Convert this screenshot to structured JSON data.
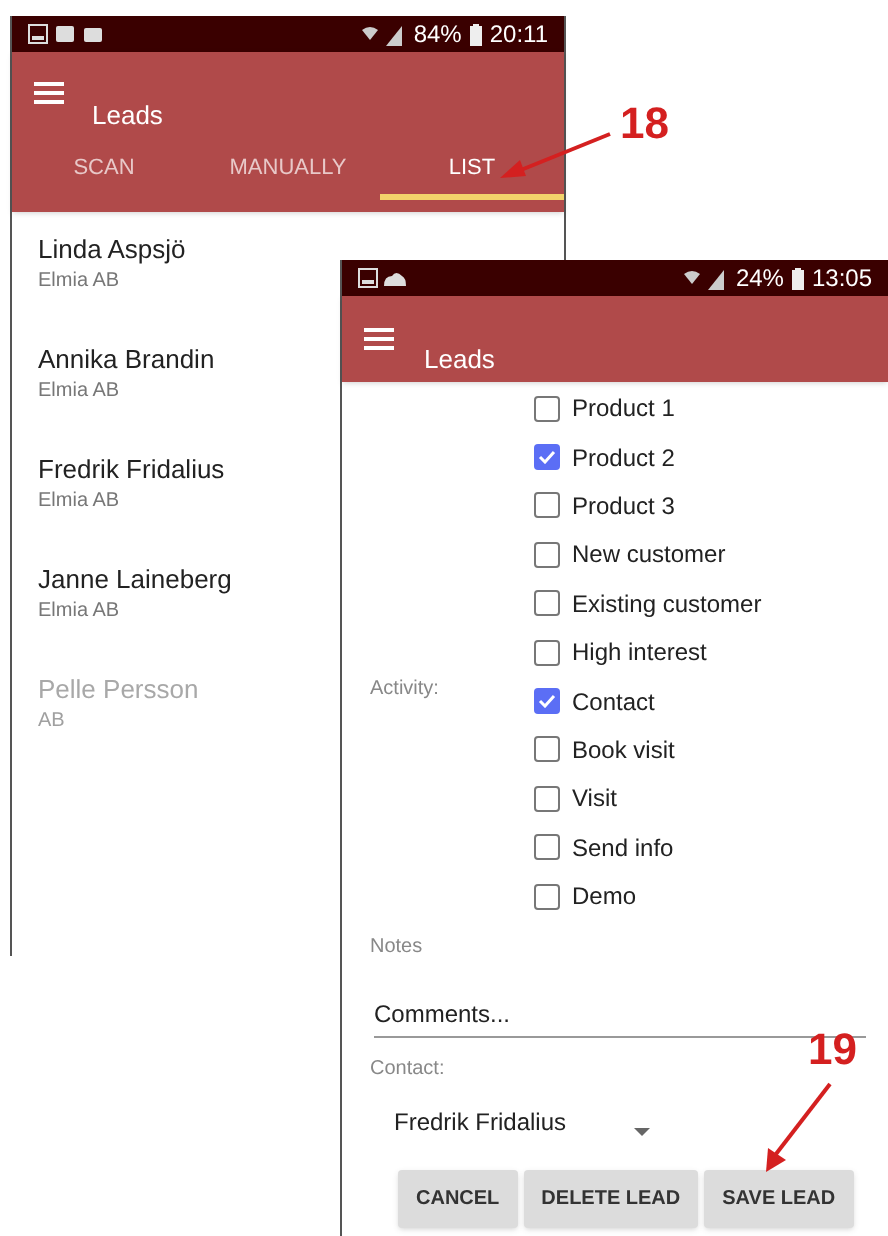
{
  "screens": [
    {
      "kind": "list",
      "status_bar": {
        "battery": "84%",
        "time": "20:11"
      },
      "title": "Leads",
      "tabs": [
        {
          "label": "SCAN",
          "selected": false
        },
        {
          "label": "MANUALLY",
          "selected": false
        },
        {
          "label": "LIST",
          "selected": true
        }
      ],
      "leads": [
        {
          "name": "Linda Aspsjö",
          "company": "Elmia AB",
          "faded": false
        },
        {
          "name": "Annika Brandin",
          "company": "Elmia AB",
          "faded": false
        },
        {
          "name": "Fredrik Fridalius",
          "company": "Elmia AB",
          "faded": false
        },
        {
          "name": "Janne Laineberg",
          "company": "Elmia AB",
          "faded": false
        },
        {
          "name": "Pelle Persson",
          "company": "AB",
          "faded": true
        }
      ]
    },
    {
      "kind": "form",
      "status_bar": {
        "battery": "24%",
        "time": "13:05"
      },
      "title": "Leads",
      "options": [
        {
          "label": "Product 1",
          "checked": false
        },
        {
          "label": "Product 2",
          "checked": true
        },
        {
          "label": "Product 3",
          "checked": false
        },
        {
          "label": "New customer",
          "checked": false
        },
        {
          "label": "Existing customer",
          "checked": false
        },
        {
          "label": "High interest",
          "checked": false
        },
        {
          "label": "Contact",
          "checked": true,
          "section": "Activity:"
        },
        {
          "label": "Book visit",
          "checked": false
        },
        {
          "label": "Visit",
          "checked": false
        },
        {
          "label": "Send info",
          "checked": false
        },
        {
          "label": "Demo",
          "checked": false
        }
      ],
      "notes_label": "Notes",
      "comments": {
        "placeholder": "Comments..."
      },
      "contact_label": "Contact:",
      "contact": "Fredrik Fridalius",
      "buttons": [
        "CANCEL",
        "DELETE LEAD",
        "SAVE LEAD"
      ]
    }
  ],
  "annotations": [
    {
      "label": "18"
    },
    {
      "label": "19"
    }
  ]
}
